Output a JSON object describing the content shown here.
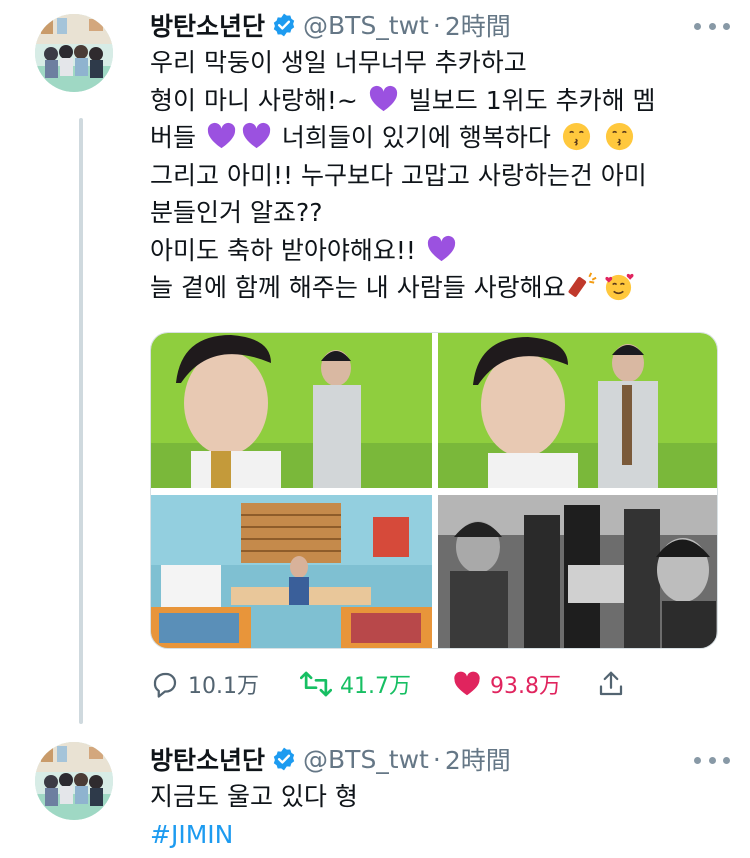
{
  "tweets": [
    {
      "display_name": "방탄소년단",
      "handle": "@BTS_twt",
      "separator": "·",
      "time": "2時間",
      "text_lines": [
        "우리 막둥이 생일 너무너무 추카하고",
        "형이 마니 사랑해!~",
        "빌보드 1위도 추카해 멤",
        "버들",
        "너희들이 있기에 행복하다",
        "그리고 아미!! 누구보다 고맙고 사랑하는건 아미",
        "분들인거 알죠??",
        "아미도 축하 받아야해요!!",
        "늘 곁에 함께 해주는 내 사람들 사랑해요"
      ],
      "emojis": [
        "purple-heart",
        "kissing-face",
        "firecracker",
        "smiling-face-with-hearts"
      ],
      "stats": {
        "replies": "10.1万",
        "retweets": "41.7万",
        "likes": "93.8万"
      },
      "colors": {
        "retweet": "#17bf63",
        "like": "#e0245e",
        "verified": "#1d9bf0"
      }
    },
    {
      "display_name": "방탄소년단",
      "handle": "@BTS_twt",
      "separator": "·",
      "time": "2時間",
      "text_lines": [
        "지금도 울고 있다 형"
      ],
      "hashtag": "#JIMIN"
    }
  ]
}
